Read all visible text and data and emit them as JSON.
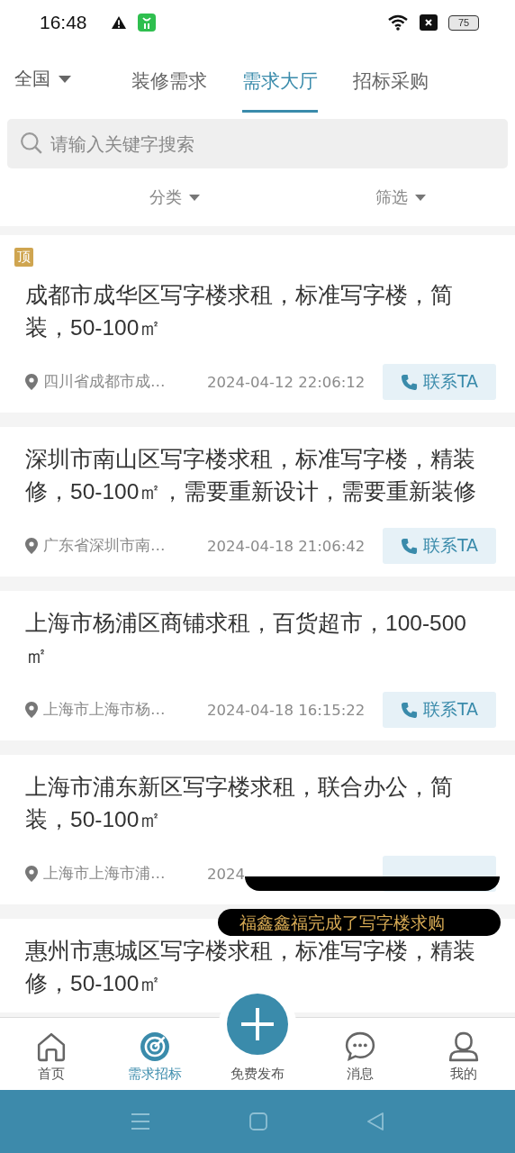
{
  "status_bar": {
    "time": "16:48",
    "battery": "75"
  },
  "region": {
    "label": "全国"
  },
  "tabs": [
    {
      "label": "装修需求",
      "selected": false
    },
    {
      "label": "需求大厅",
      "selected": true
    },
    {
      "label": "招标采购",
      "selected": false
    }
  ],
  "search": {
    "placeholder": "请输入关键字搜索"
  },
  "filters": [
    {
      "label": "分类"
    },
    {
      "label": "筛选"
    }
  ],
  "listings": [
    {
      "pinned": true,
      "pin_label": "顶",
      "title": "成都市成华区写字楼求租，标准写字楼，简装，50-100㎡",
      "location": "四川省成都市成…",
      "date": "2024-04-12 22:06:12",
      "contact": "联系TA"
    },
    {
      "pinned": false,
      "title": "深圳市南山区写字楼求租，标准写字楼，精装修，50-100㎡，需要重新设计，需要重新装修",
      "location": "广东省深圳市南…",
      "date": "2024-04-18 21:06:42",
      "contact": "联系TA"
    },
    {
      "pinned": false,
      "title": "上海市杨浦区商铺求租，百货超市，100-500㎡",
      "location": "上海市上海市杨…",
      "date": "2024-04-18 16:15:22",
      "contact": "联系TA"
    },
    {
      "pinned": false,
      "title": "上海市浦东新区写字楼求租，联合办公，简装，50-100㎡",
      "location": "上海市上海市浦…",
      "date": "2024"
    },
    {
      "pinned": false,
      "title": "惠州市惠城区写字楼求租，标准写字楼，精装修，50-100㎡"
    }
  ],
  "toasts": [
    {
      "kind": "pill"
    },
    {
      "kind": "message",
      "text": "福鑫鑫福完成了写字楼求购"
    }
  ],
  "bottom_nav": [
    {
      "kind": "home",
      "label": "首页",
      "selected": false
    },
    {
      "kind": "target",
      "label": "需求招标",
      "selected": true
    },
    {
      "kind": "publish",
      "label": "免费发布",
      "selected": false
    },
    {
      "kind": "chat",
      "label": "消息",
      "selected": false
    },
    {
      "kind": "user",
      "label": "我的",
      "selected": false
    }
  ]
}
